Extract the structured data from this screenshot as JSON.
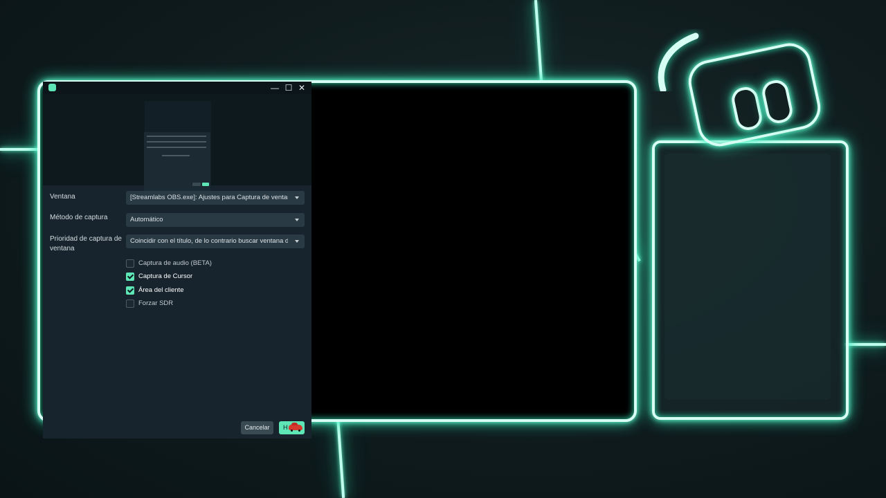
{
  "window": {
    "minimize_glyph": "—",
    "maximize_glyph": "☐",
    "close_glyph": "✕"
  },
  "form": {
    "window_label": "Ventana",
    "window_value": "[Streamlabs OBS.exe]: Ajustes para Captura de ventana",
    "method_label": "Método de captura",
    "method_value": "Automático",
    "priority_label_line1": "Prioridad de captura de",
    "priority_label_line2": "ventana",
    "priority_value": "Coincidir con el título, de lo contrario buscar ventana d..."
  },
  "checkboxes": [
    {
      "label": "Captura de audio (BETA)",
      "checked": false
    },
    {
      "label": "Captura de Cursor",
      "checked": true
    },
    {
      "label": "Área del cliente",
      "checked": true
    },
    {
      "label": "Forzar SDR",
      "checked": false
    }
  ],
  "footer": {
    "cancel_label": "Cancelar",
    "done_label": "H"
  },
  "colors": {
    "accent": "#5ee6b6",
    "neon": "#6fffd6",
    "dialog_bg": "#17242d"
  }
}
